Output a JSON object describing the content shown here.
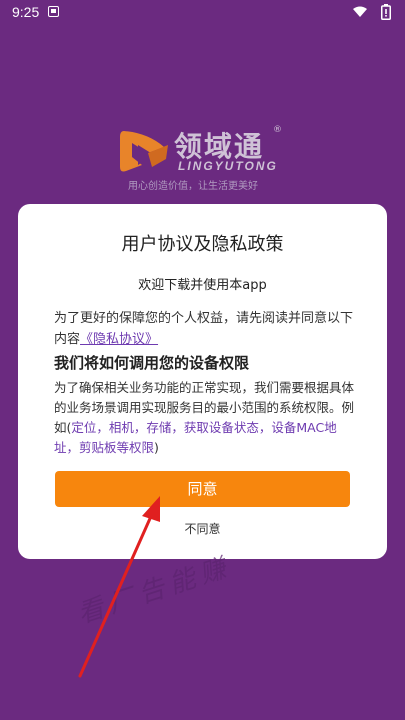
{
  "status_bar": {
    "time": "9:25"
  },
  "logo": {
    "name": "领域通",
    "registered": "®",
    "pinyin": "LINGYUTONG",
    "slogan": "用心创造价值，让生活更美好",
    "brand_color": "#e8842a"
  },
  "dialog": {
    "title": "用户协议及隐私政策",
    "welcome": "欢迎下载并使用本app",
    "intro_text": "为了更好的保障您的个人权益，请先阅读并同意以下内容",
    "privacy_link": "《隐私协议》",
    "permissions_heading": "我们将如何调用您的设备权限",
    "permissions_text": "为了确保相关业务功能的正常实现，我们需要根据具体的业务场景调用实现服务目的最小范围的系统权限。例如(",
    "permissions_list": "定位，相机，存储，获取设备状态，设备MAC地址，剪贴板等权限",
    "permissions_close": ")",
    "agree_label": "同意",
    "disagree_label": "不同意"
  },
  "watermark": "看厂告能赚",
  "colors": {
    "background": "#6b2a80",
    "accent": "#f7860d",
    "link": "#6e3bb0",
    "arrow": "#e02020"
  }
}
